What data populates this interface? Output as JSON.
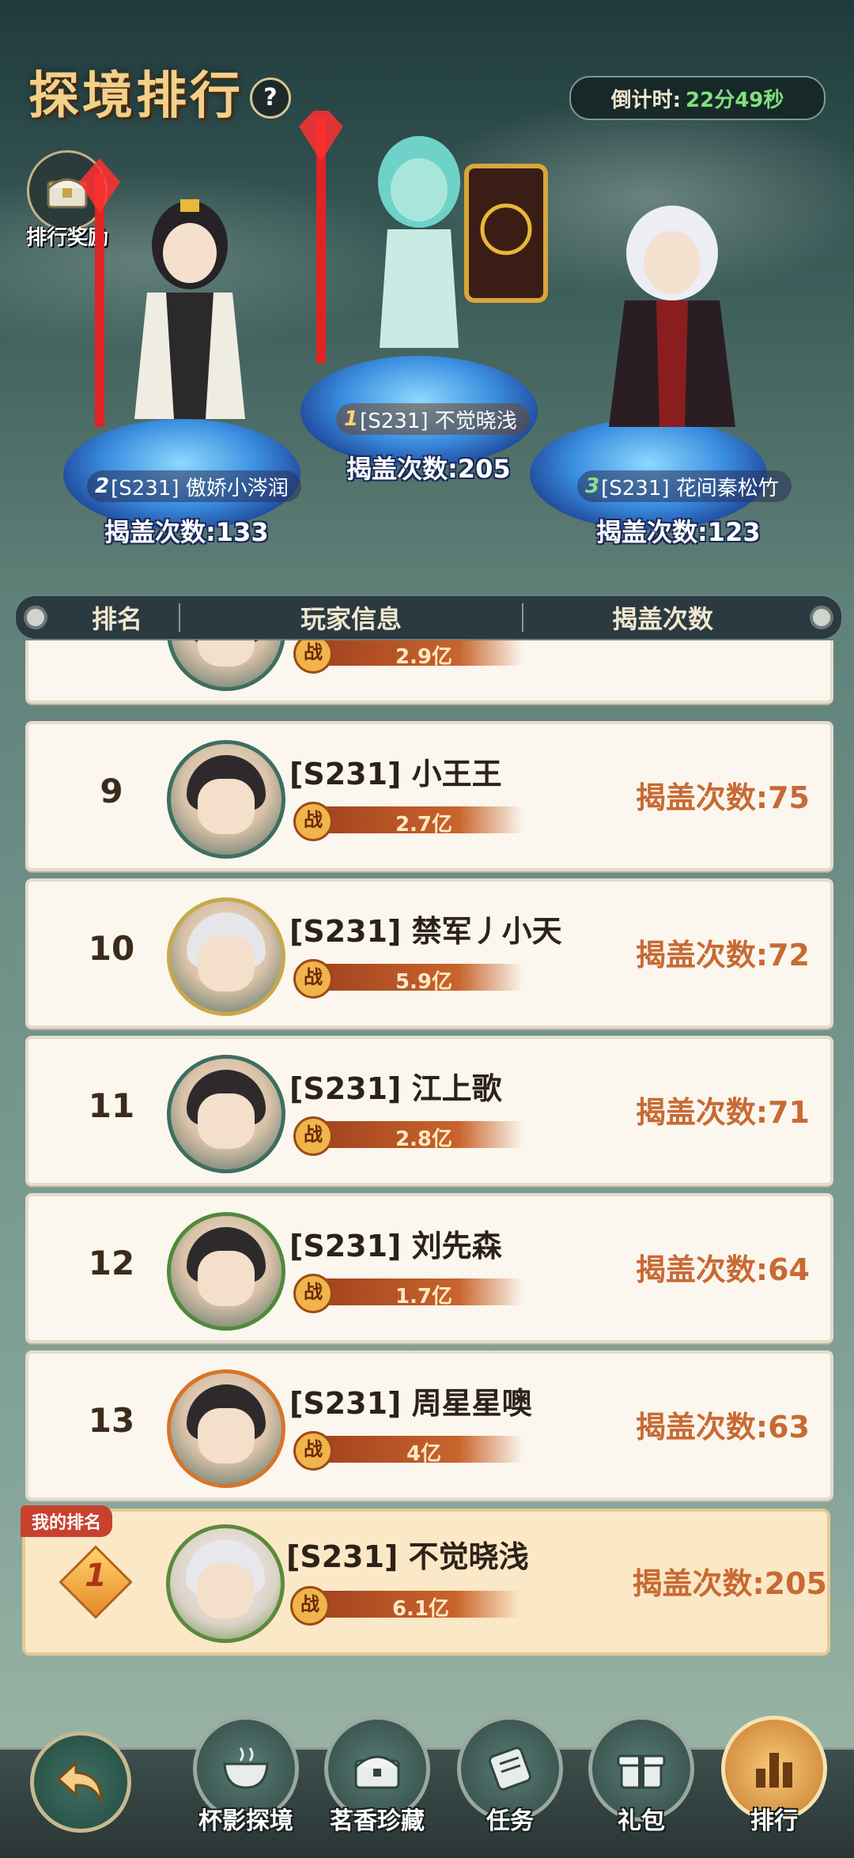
{
  "header": {
    "title": "探境排行",
    "help": "?",
    "timer_label": "倒计时:",
    "timer_value": "22分49秒",
    "reward_label": "排行奖励"
  },
  "podium": [
    {
      "rank": "2",
      "name": "[S231] 傲娇小涔润",
      "count": "揭盖次数:133"
    },
    {
      "rank": "1",
      "name": "[S231] 不觉晓浅",
      "count": "揭盖次数:205"
    },
    {
      "rank": "3",
      "name": "[S231] 花间秦松竹",
      "count": "揭盖次数:123"
    }
  ],
  "table_header": {
    "col_rank": "排名",
    "col_player": "玩家信息",
    "col_count": "揭盖次数"
  },
  "power_badge": "战",
  "partial_row": {
    "power": "2.9亿"
  },
  "rows": [
    {
      "rank": "9",
      "name": "[S231] 小王王",
      "power": "2.7亿",
      "count": "揭盖次数:75"
    },
    {
      "rank": "10",
      "name": "[S231] 禁军丿小天",
      "power": "5.9亿",
      "count": "揭盖次数:72"
    },
    {
      "rank": "11",
      "name": "[S231] 江上歌",
      "power": "2.8亿",
      "count": "揭盖次数:71"
    },
    {
      "rank": "12",
      "name": "[S231] 刘先森",
      "power": "1.7亿",
      "count": "揭盖次数:64"
    },
    {
      "rank": "13",
      "name": "[S231] 周星星噢",
      "power": "4亿",
      "count": "揭盖次数:63"
    }
  ],
  "my_rank": {
    "tag": "我的排名",
    "rank": "1",
    "name": "[S231] 不觉晓浅",
    "power": "6.1亿",
    "count": "揭盖次数:205"
  },
  "nav": {
    "tabs": [
      "杯影探境",
      "茗香珍藏",
      "任务",
      "礼包",
      "排行"
    ],
    "active": "排行"
  },
  "colors": {
    "accent_orange": "#c86a34",
    "title_gold": "#f3d089",
    "timer_green": "#7fe07a"
  }
}
